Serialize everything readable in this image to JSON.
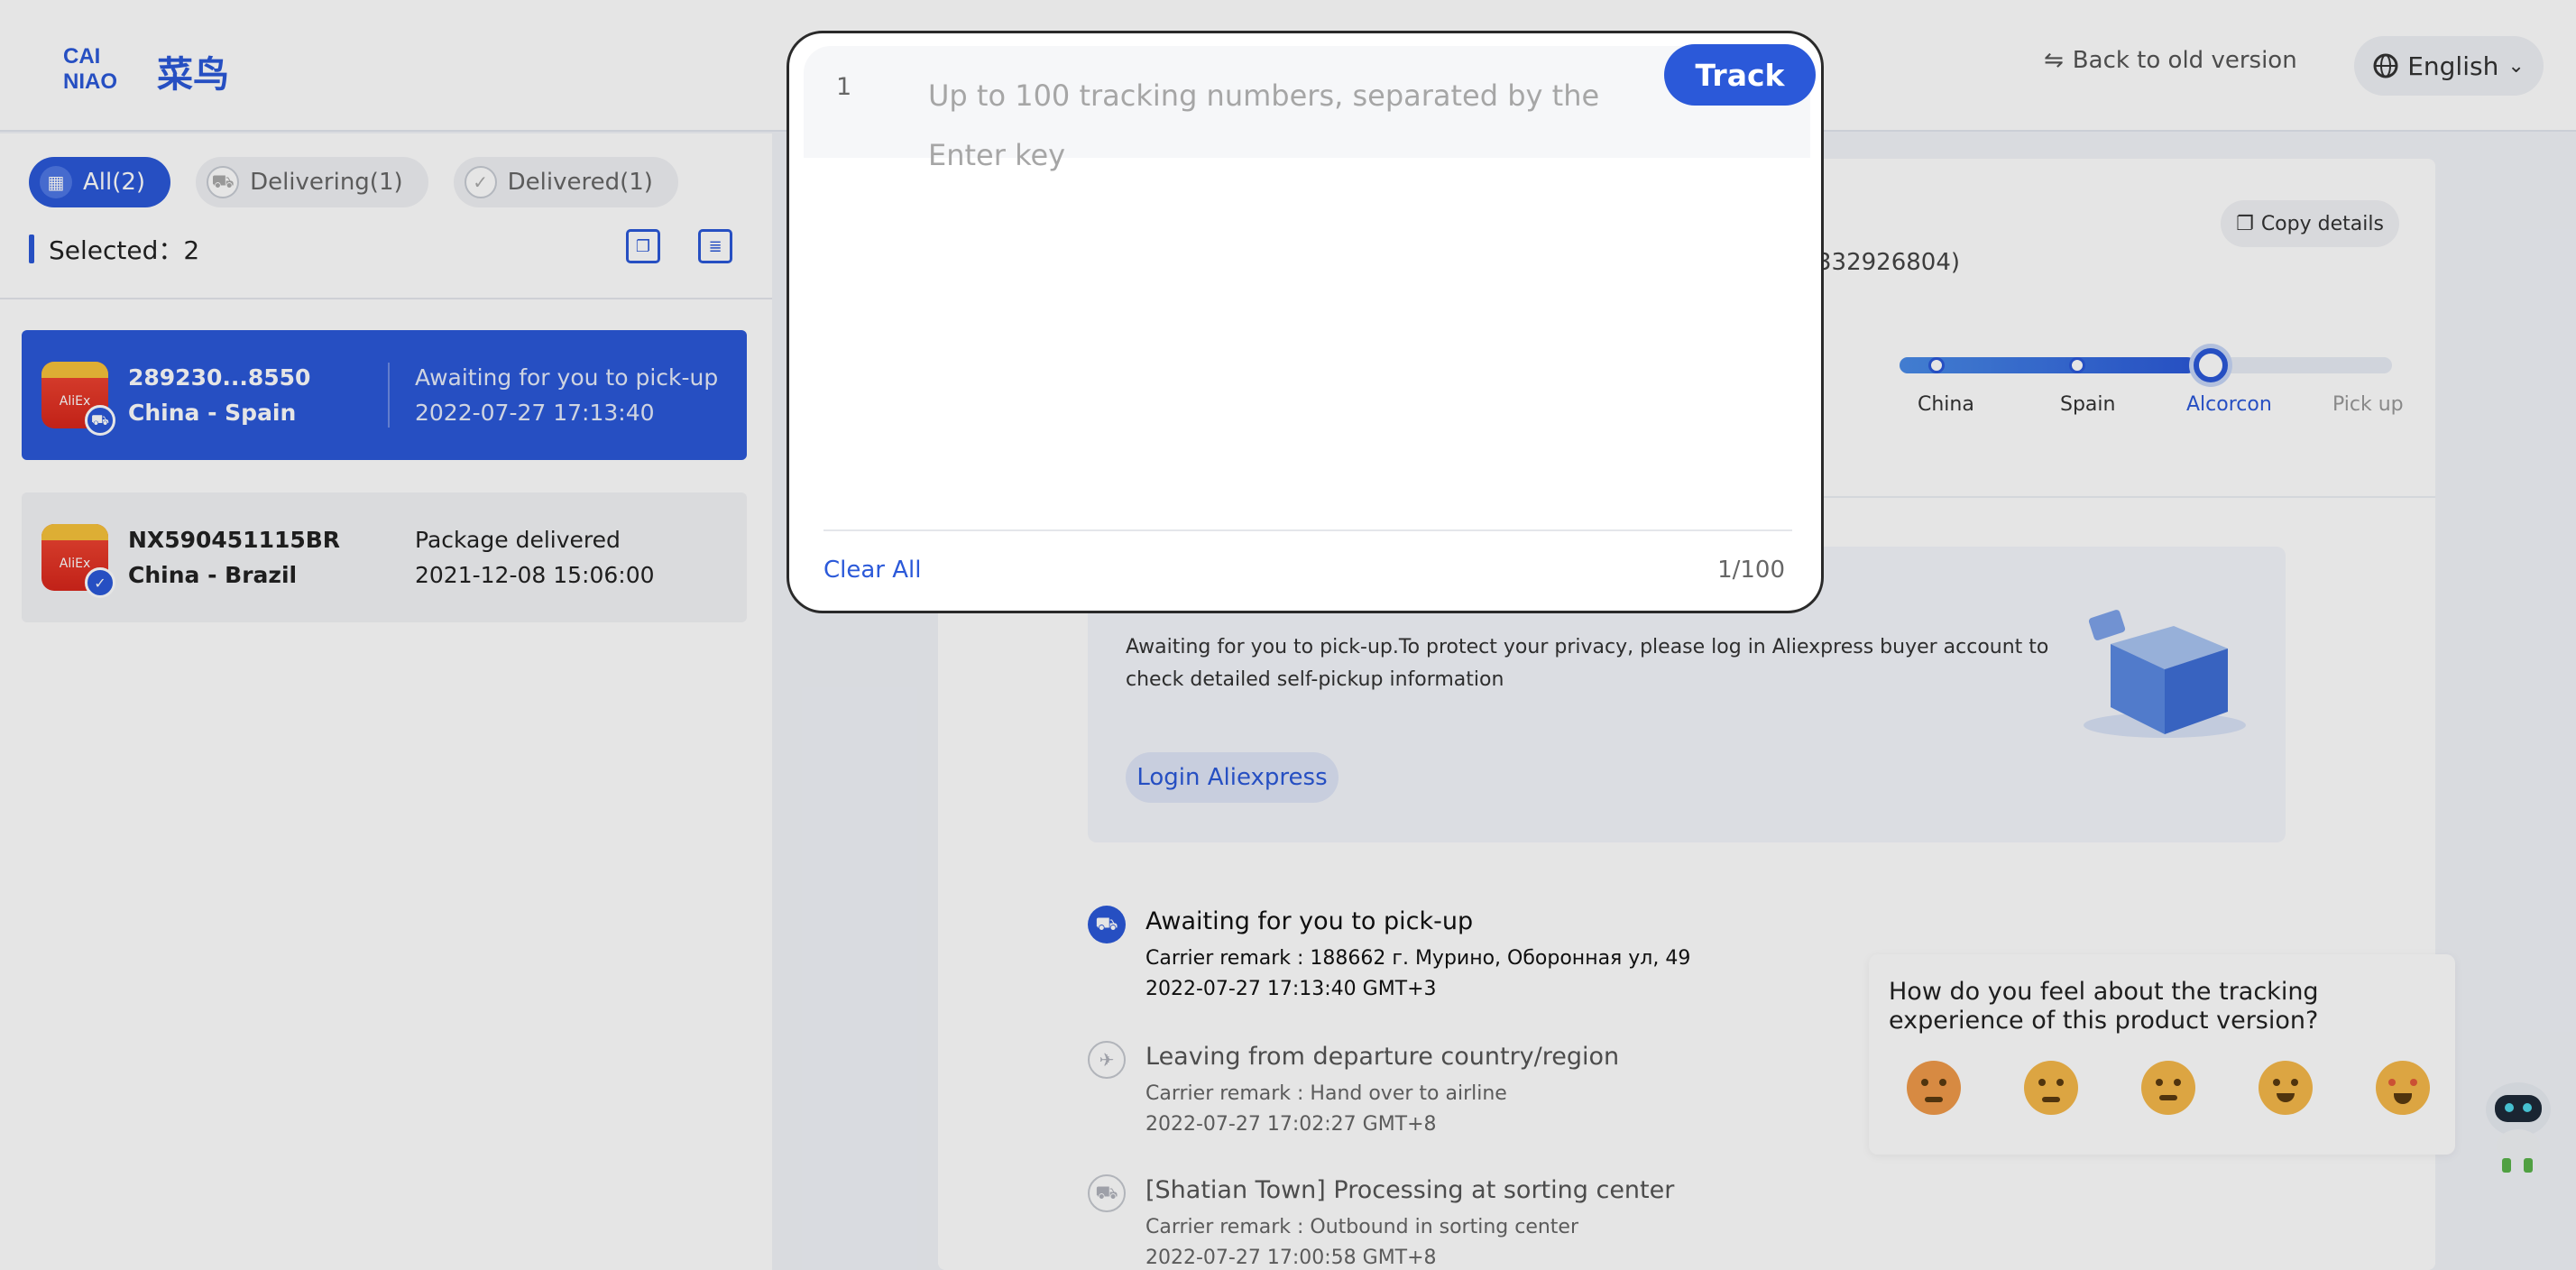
{
  "header": {
    "logo_text": "CAINIAO 菜鸟",
    "back_label": "Back to old version",
    "language": "English"
  },
  "filters": [
    {
      "label": "All(2)",
      "active": true
    },
    {
      "label": "Delivering(1)",
      "active": false
    },
    {
      "label": "Delivered(1)",
      "active": false
    }
  ],
  "selected_label": "Selected：2",
  "packages": [
    {
      "number": "289230...8550",
      "route": "China - Spain",
      "status": "Awaiting for you to pick-up",
      "time": "2022-07-27 17:13:40"
    },
    {
      "number": "NX590451115BR",
      "route": "China - Brazil",
      "status": "Package delivered",
      "time": "2021-12-08 15:06:00"
    }
  ],
  "detail": {
    "copy_label": "Copy details",
    "partial_number": "332926804)",
    "progress_fraction": 0.6,
    "stops": [
      {
        "label": "China",
        "state": "done"
      },
      {
        "label": "Spain",
        "state": "done"
      },
      {
        "label": "Alcorcon",
        "state": "current"
      },
      {
        "label": "Pick up",
        "state": "future"
      }
    ],
    "pickup_text": "Awaiting for you to pick-up.To protect your privacy, please log in Aliexpress buyer account to check detailed self-pickup information",
    "login_label": "Login Aliexpress",
    "timeline": [
      {
        "title": "Awaiting for you to pick-up",
        "remark": "Carrier remark : 188662 г. Мурино, Оборонная ул, 49",
        "time": "2022-07-27 17:13:40 GMT+3",
        "state": "active"
      },
      {
        "title": "Leaving from departure country/region",
        "remark": "Carrier remark : Hand over to airline",
        "time": "2022-07-27 17:02:27 GMT+8",
        "state": "past"
      },
      {
        "title": "[Shatian Town] Processing at sorting center",
        "remark": "Carrier remark : Outbound in sorting center",
        "time": "2022-07-27 17:00:58 GMT+8",
        "state": "past"
      }
    ]
  },
  "feedback": {
    "question": "How do you feel about the tracking experience of this product version?",
    "emojis": [
      "angry-face",
      "sad-face",
      "neutral-face",
      "happy-face",
      "star-struck-face"
    ]
  },
  "modal": {
    "line_number": "1",
    "placeholder": "Up to 100 tracking numbers, separated by the Enter key",
    "track_label": "Track",
    "clear_label": "Clear All",
    "count": "1/100"
  },
  "colors": {
    "accent": "#2b59d9",
    "background": "#f2f4f9"
  }
}
